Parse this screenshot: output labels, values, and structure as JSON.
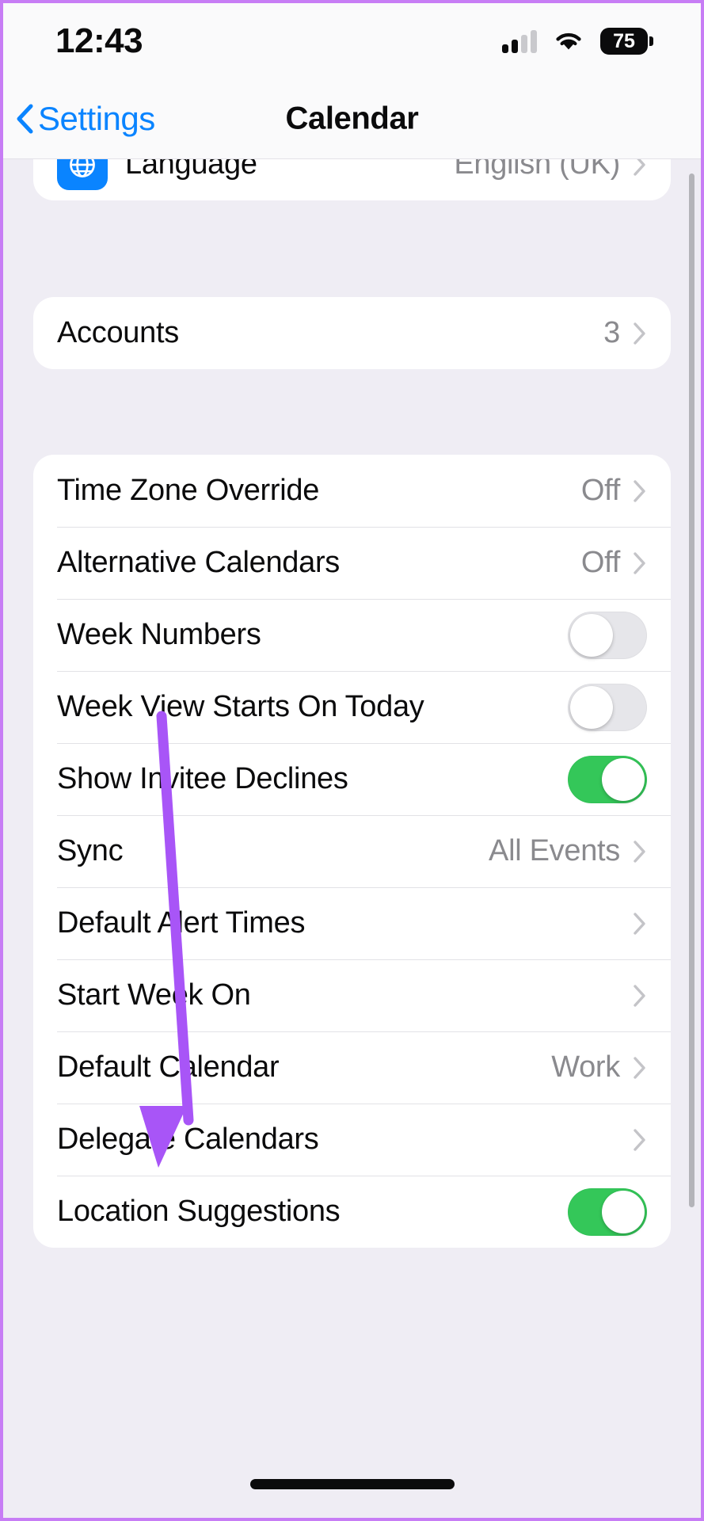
{
  "status_bar": {
    "time": "12:43",
    "signal_icon": "cellular-signal-icon",
    "wifi_icon": "wifi-icon",
    "battery_level": "75",
    "battery_icon": "battery-icon"
  },
  "nav_bar": {
    "back_label": "Settings",
    "back_icon": "chevron-left-icon",
    "title": "Calendar"
  },
  "groups": [
    {
      "name": "language-group",
      "clipped": true,
      "rows": [
        {
          "label": "Language",
          "value": "English (UK)",
          "icon": "globe-icon",
          "control": "chevron"
        }
      ]
    },
    {
      "name": "accounts-group",
      "rows": [
        {
          "label": "Accounts",
          "value": "3",
          "control": "chevron"
        }
      ]
    },
    {
      "name": "calendar-options-group",
      "rows": [
        {
          "label": "Time Zone Override",
          "value": "Off",
          "control": "chevron"
        },
        {
          "label": "Alternative Calendars",
          "value": "Off",
          "control": "chevron"
        },
        {
          "label": "Week Numbers",
          "value": "",
          "control": "toggle",
          "toggle_on": false
        },
        {
          "label": "Week View Starts On Today",
          "value": "",
          "control": "toggle",
          "toggle_on": false
        },
        {
          "label": "Show Invitee Declines",
          "value": "",
          "control": "toggle",
          "toggle_on": true
        },
        {
          "label": "Sync",
          "value": "All Events",
          "control": "chevron"
        },
        {
          "label": "Default Alert Times",
          "value": "",
          "control": "chevron"
        },
        {
          "label": "Start Week On",
          "value": "",
          "control": "chevron"
        },
        {
          "label": "Default Calendar",
          "value": "Work",
          "control": "chevron"
        },
        {
          "label": "Delegate Calendars",
          "value": "",
          "control": "chevron"
        },
        {
          "label": "Location Suggestions",
          "value": "",
          "control": "toggle",
          "toggle_on": true
        }
      ]
    }
  ],
  "annotation": {
    "name": "highlight-arrow",
    "target_label": "Default Calendar",
    "color": "#A855F7"
  },
  "colors": {
    "accent_blue": "#0A84FF",
    "toggle_on_green": "#34C759",
    "toggle_off_gray": "#E6E6EA",
    "page_background": "#EFEDF4",
    "card_background": "#FFFFFF",
    "secondary_text": "#8A8A8E",
    "frame_border": "#C77DF5"
  },
  "home_indicator": "home-indicator"
}
